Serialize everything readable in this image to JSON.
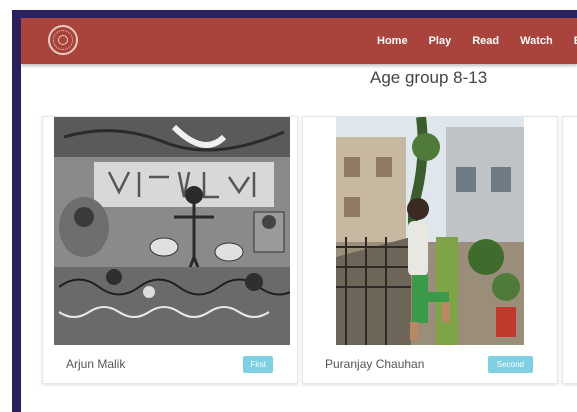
{
  "navbar": {
    "logo_icon": "circular-emblem-icon",
    "links": [
      {
        "label": "Home"
      },
      {
        "label": "Play"
      },
      {
        "label": "Read"
      },
      {
        "label": "Watch"
      },
      {
        "label": "En"
      }
    ],
    "background_color": "#a8443b"
  },
  "page": {
    "title": "Age group 8-13"
  },
  "cards": [
    {
      "name": "Arjun Malik",
      "rank": "First",
      "image": "pencil-sketch-artwork"
    },
    {
      "name": "Puranjay Chauhan",
      "rank": "Second",
      "image": "boy-on-balcony-photo"
    }
  ],
  "colors": {
    "badge": "#7fd0e3",
    "frame": "#2c1f5e"
  }
}
